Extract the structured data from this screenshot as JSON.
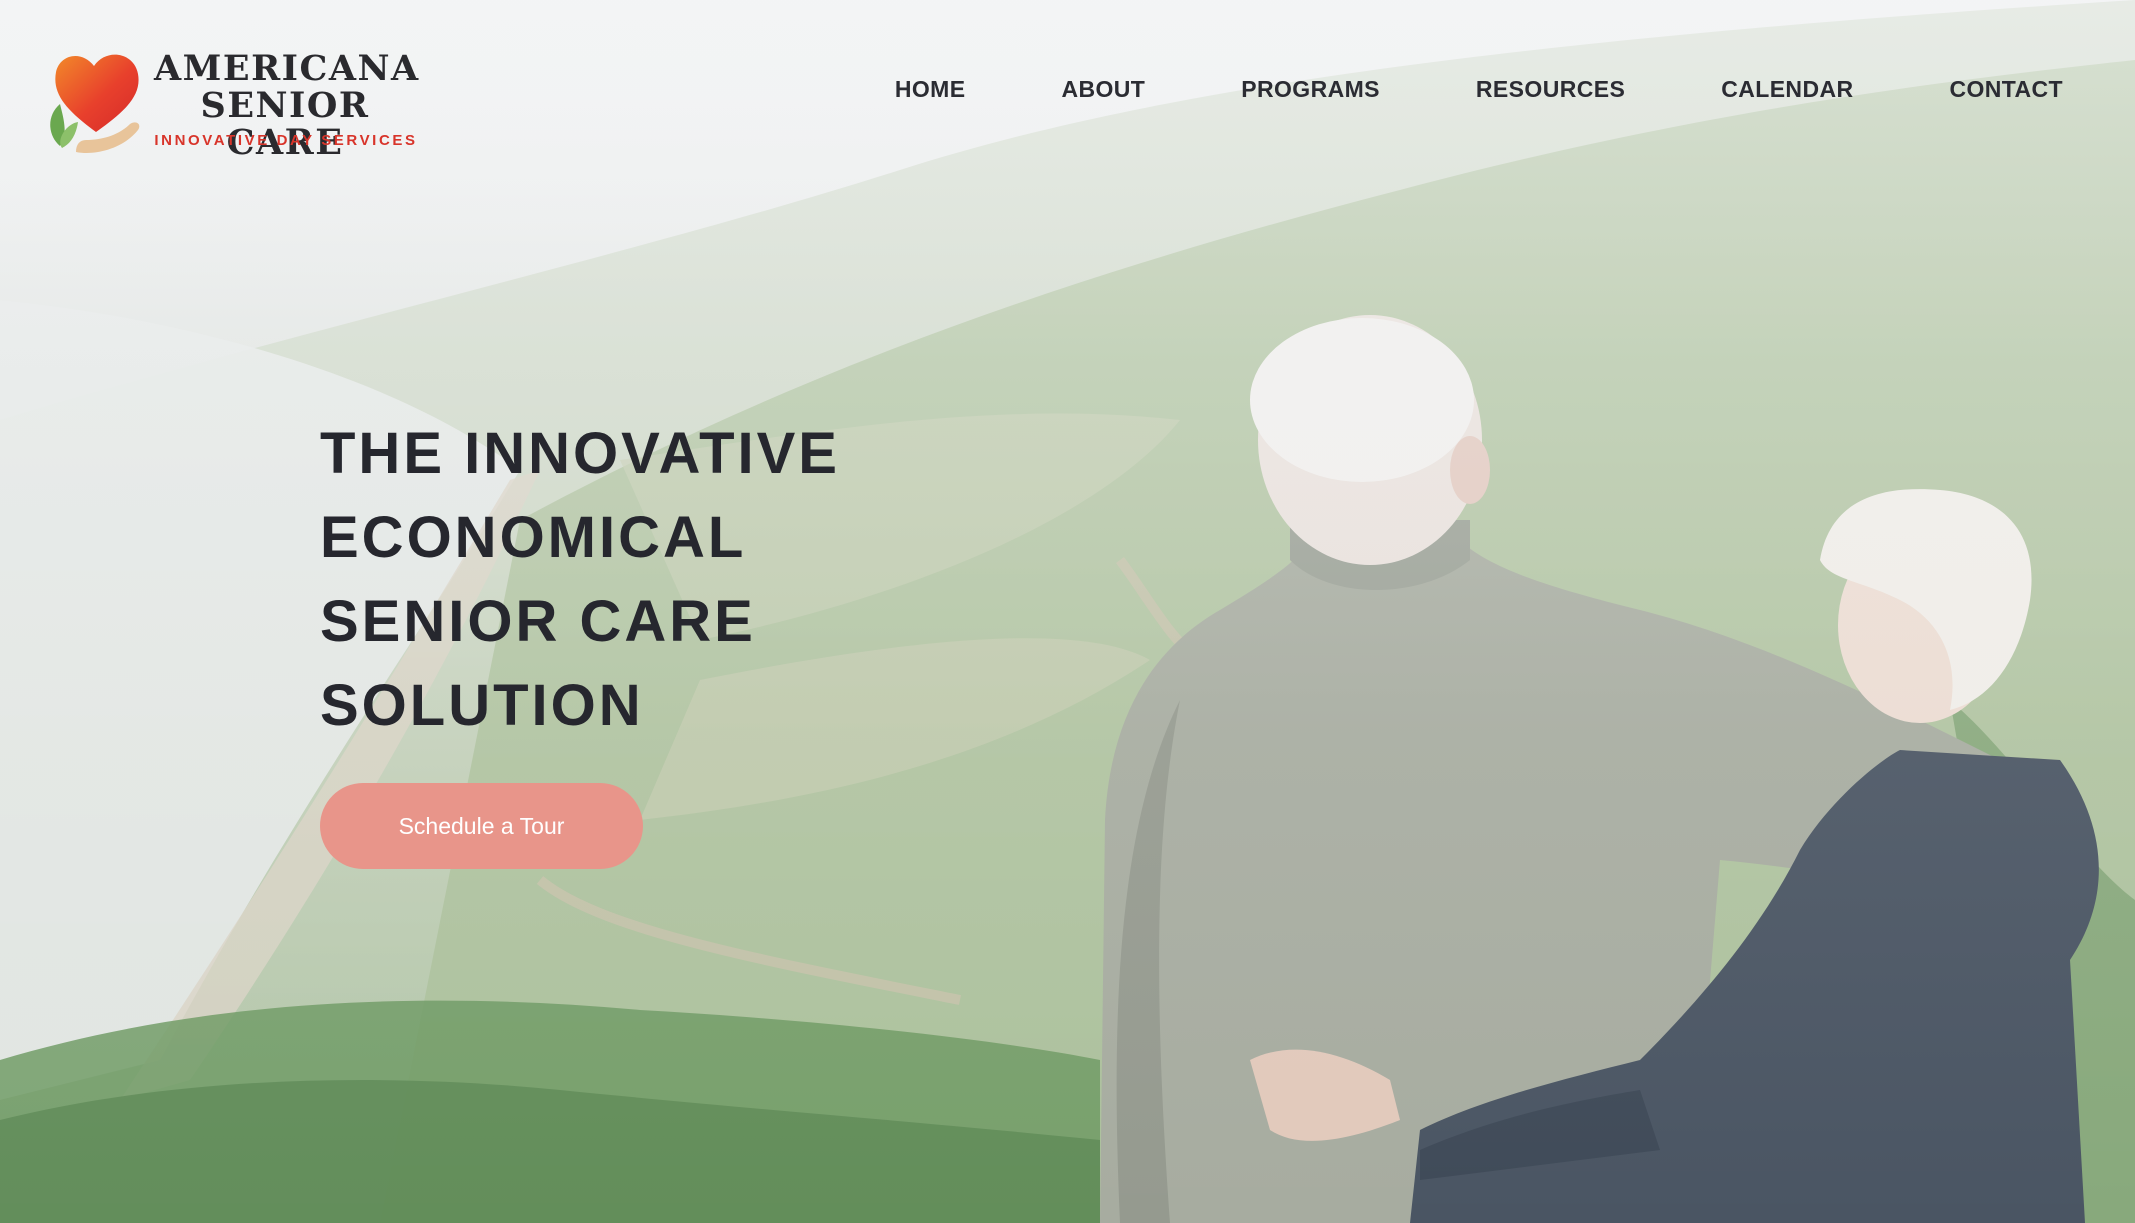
{
  "brand": {
    "name_line1": "AMERICANA",
    "name_line2": "SENIOR CARE",
    "tagline": "INNOVATIVE DAY SERVICES",
    "colors": {
      "heart": "#e8402c",
      "leaf": "#6aa84f",
      "hand": "#e8c49a",
      "tagline": "#d8342a"
    }
  },
  "nav": {
    "items": [
      {
        "label": "HOME"
      },
      {
        "label": "ABOUT"
      },
      {
        "label": "PROGRAMS"
      },
      {
        "label": "RESOURCES"
      },
      {
        "label": "CALENDAR"
      },
      {
        "label": "CONTACT"
      }
    ]
  },
  "hero": {
    "title_lines": [
      "THE INNOVATIVE",
      "ECONOMICAL",
      "SENIOR CARE",
      "SOLUTION"
    ],
    "cta_label": "Schedule a Tour",
    "cta_color": "#e8958a"
  },
  "icons": {
    "logo": "heart-hands-leaf-icon"
  }
}
